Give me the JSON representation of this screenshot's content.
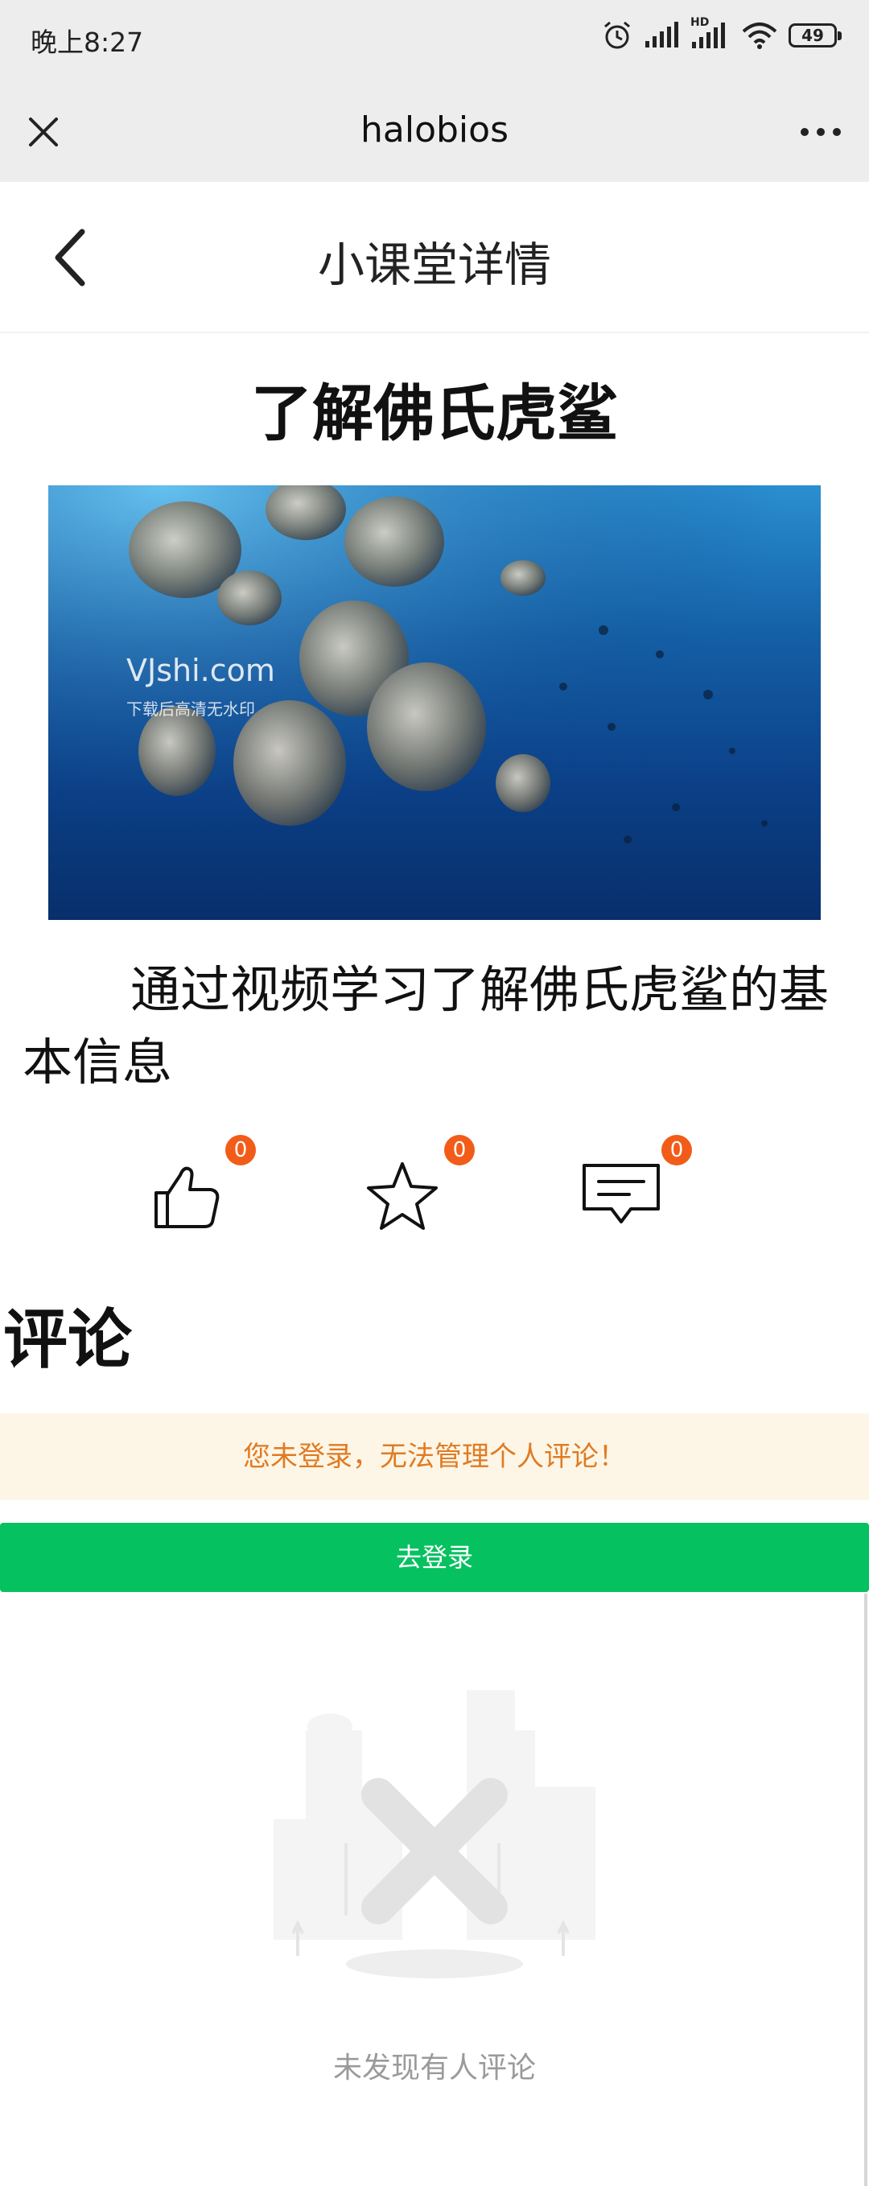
{
  "status_bar": {
    "time": "晚上8:27",
    "network": "HD",
    "battery": "49"
  },
  "wechat_bar": {
    "title": "halobios"
  },
  "page_header": {
    "title": "小课堂详情"
  },
  "article": {
    "title": "了解佛氏虎鲨",
    "video": {
      "watermark": "VJshi.com",
      "watermark_sub": "下载后高清无水印"
    },
    "description": "通过视频学习了解佛氏虎鲨的基本信息"
  },
  "actions": {
    "like_count": "0",
    "favorite_count": "0",
    "comment_count": "0"
  },
  "comments": {
    "heading": "评论",
    "notice": "您未登录，无法管理个人评论！",
    "login_button": "去登录",
    "empty_text": "未发现有人评论"
  },
  "colors": {
    "badge": "#f25c19",
    "login_button": "#06c160",
    "notice_bg": "#fdf6e6",
    "notice_text": "#e07b23"
  }
}
